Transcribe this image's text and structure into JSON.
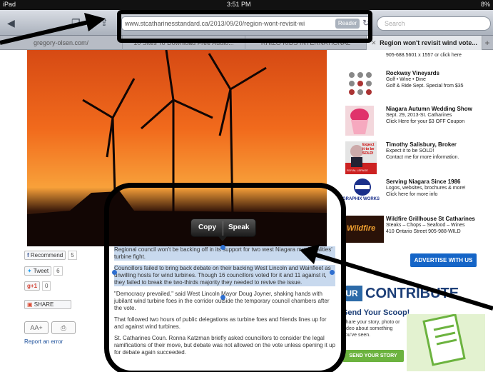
{
  "status_bar": {
    "device": "iPad",
    "time": "3:51 PM",
    "battery": "8%"
  },
  "toolbar": {
    "url": "www.stcatharinesstandard.ca/2013/09/20/region-wont-revisit-wi",
    "reader_label": "Reader",
    "search_placeholder": "Search"
  },
  "tabs": [
    {
      "label": "gregory-olsen.com/"
    },
    {
      "label": "10 Sites To Download Free Audio..."
    },
    {
      "label": "RHIZO KIDS INTERNATIONAL"
    },
    {
      "label": "Region won't revisit wind vote...",
      "close": "✕"
    }
  ],
  "tab_add": "+",
  "popup": {
    "copy": "Copy",
    "speak": "Speak"
  },
  "share": {
    "recommend": "Recommend",
    "recommend_count": "5",
    "tweet": "Tweet",
    "tweet_count": "6",
    "plus_one": "+1",
    "plus_count": "0",
    "share": "SHARE",
    "font_larger": "AA+",
    "print_icon": "⎙",
    "report": "Report an error"
  },
  "article": {
    "p1": "Regional council won't be backing off in its support for two west Niagara municipalities' turbine fight.",
    "p2": "Councillors failed to bring back debate on their backing West Lincoln and Wainfleet as unwilling hosts for wind turbines. Though 16 councillors voted for it and 11 against it, they failed to break the two-thirds majority they needed to revive the issue.",
    "p3": "\"Democracy prevailed,\" said West Lincoln Mayor Doug Joyner, shaking hands with jubilant wind turbine foes in the corridor outside the temporary council chambers after the vote.",
    "p4": "That followed two hours of public delegations as turbine foes and friends lines up for and against wind turbines.",
    "p5": "St. Catharines Coun. Ronna Katzman briefly asked councillors to consider the legal ramifications of their move, but debate was not allowed on the vote unless opening it up for debate again succeeded."
  },
  "ads": [
    {
      "title": "",
      "lines": [
        "905-688.5601 x 1557 or click here"
      ]
    },
    {
      "title": "Rockway Vineyards",
      "lines": [
        "Golf • Wine • Dine",
        "Golf & Ride Sept. Special from $35"
      ]
    },
    {
      "title": "Niagara Autumn Wedding Show",
      "lines": [
        "Sept. 29, 2013-St. Catharines",
        "Click Here for your $3 OFF Coupon"
      ]
    },
    {
      "title": "Timothy Salisbury, Broker",
      "lines": [
        "Expect it to be SOLD!",
        "Contact me for more information."
      ],
      "badge": "Expect it to be SOLD!",
      "badge2": "ROYAL LEPAGE"
    },
    {
      "title": "Serving Niagara Since 1986",
      "lines": [
        "Logos, websites, brochures & more!",
        "Click here for more info"
      ],
      "logo": "GRAPHIX WORKS"
    },
    {
      "title": "Wildfire Grillhouse St Catharines",
      "lines": [
        "Steaks – Chops – Seafood – Wines",
        "410 Ontario Street  905-988-WILD"
      ],
      "logo": "Wildfire"
    }
  ],
  "advertise": "ADVERTISE WITH US",
  "contribute": {
    "logo": "UR",
    "heading": "CONTRIBUTE",
    "scoop": "Send Your Scoop!",
    "desc": "Share your story, photo or video about something you've seen.",
    "button": "SEND YOUR STORY"
  },
  "colors": {
    "accent": "#1565c7",
    "annotation": "#000000",
    "selection": "#c8d9ee"
  }
}
